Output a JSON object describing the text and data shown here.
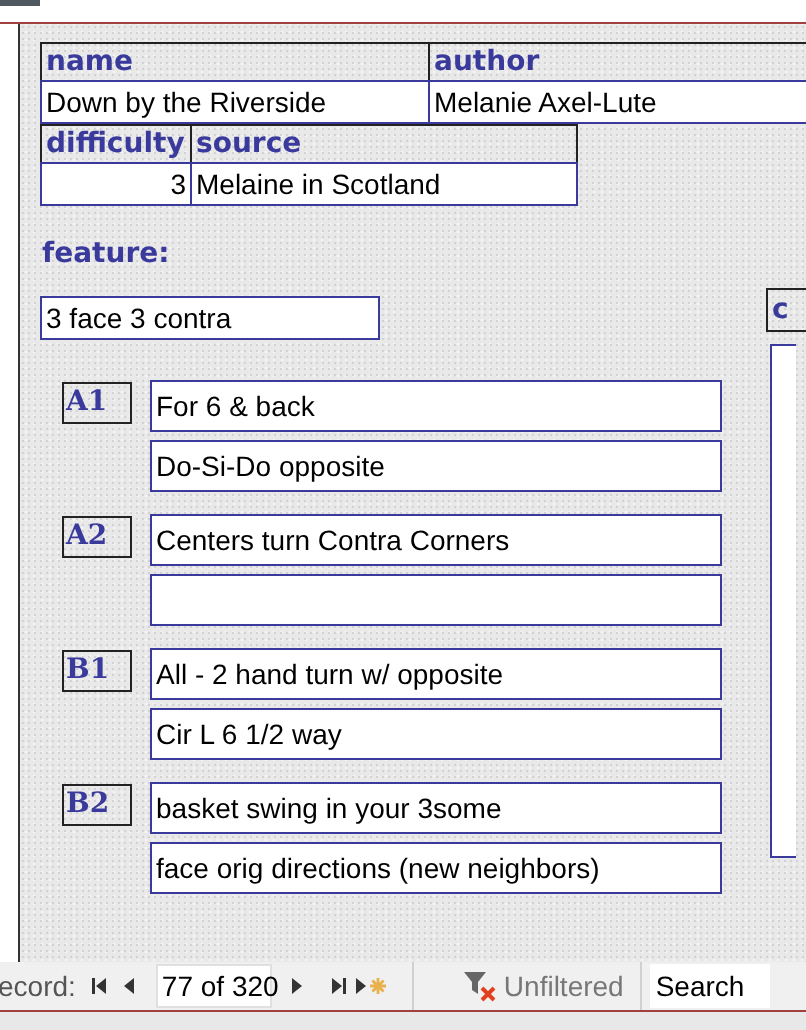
{
  "record_header": [
    {
      "name_label": "name",
      "name": "Down by the Riverside",
      "author_label": "author",
      "author": "Melanie Axel-Lute"
    }
  ],
  "details": {
    "difficulty_label": "difficulty",
    "difficulty": "3",
    "source_label": "source",
    "source": "Melaine in Scotland"
  },
  "feature": {
    "label": "feature:",
    "value": "3 face 3 contra"
  },
  "figures": [
    {
      "label": "A1",
      "lines": [
        "For 6 & back",
        "Do-Si-Do opposite"
      ]
    },
    {
      "label": "A2",
      "lines": [
        "Centers turn Contra Corners"
      ]
    },
    {
      "label": "B1",
      "lines": [
        "All - 2 hand turn w/ opposite",
        "Cir L 6 1/2 way"
      ]
    },
    {
      "label": "B2",
      "lines": [
        "basket swing in your 3some",
        "face orig directions (new neighbors)"
      ]
    }
  ],
  "side_panel": {
    "label": "c"
  },
  "navigation": {
    "label": "ecord:",
    "position": "77 of 320",
    "filter": "Unfiltered",
    "placeholder": "Search"
  }
}
